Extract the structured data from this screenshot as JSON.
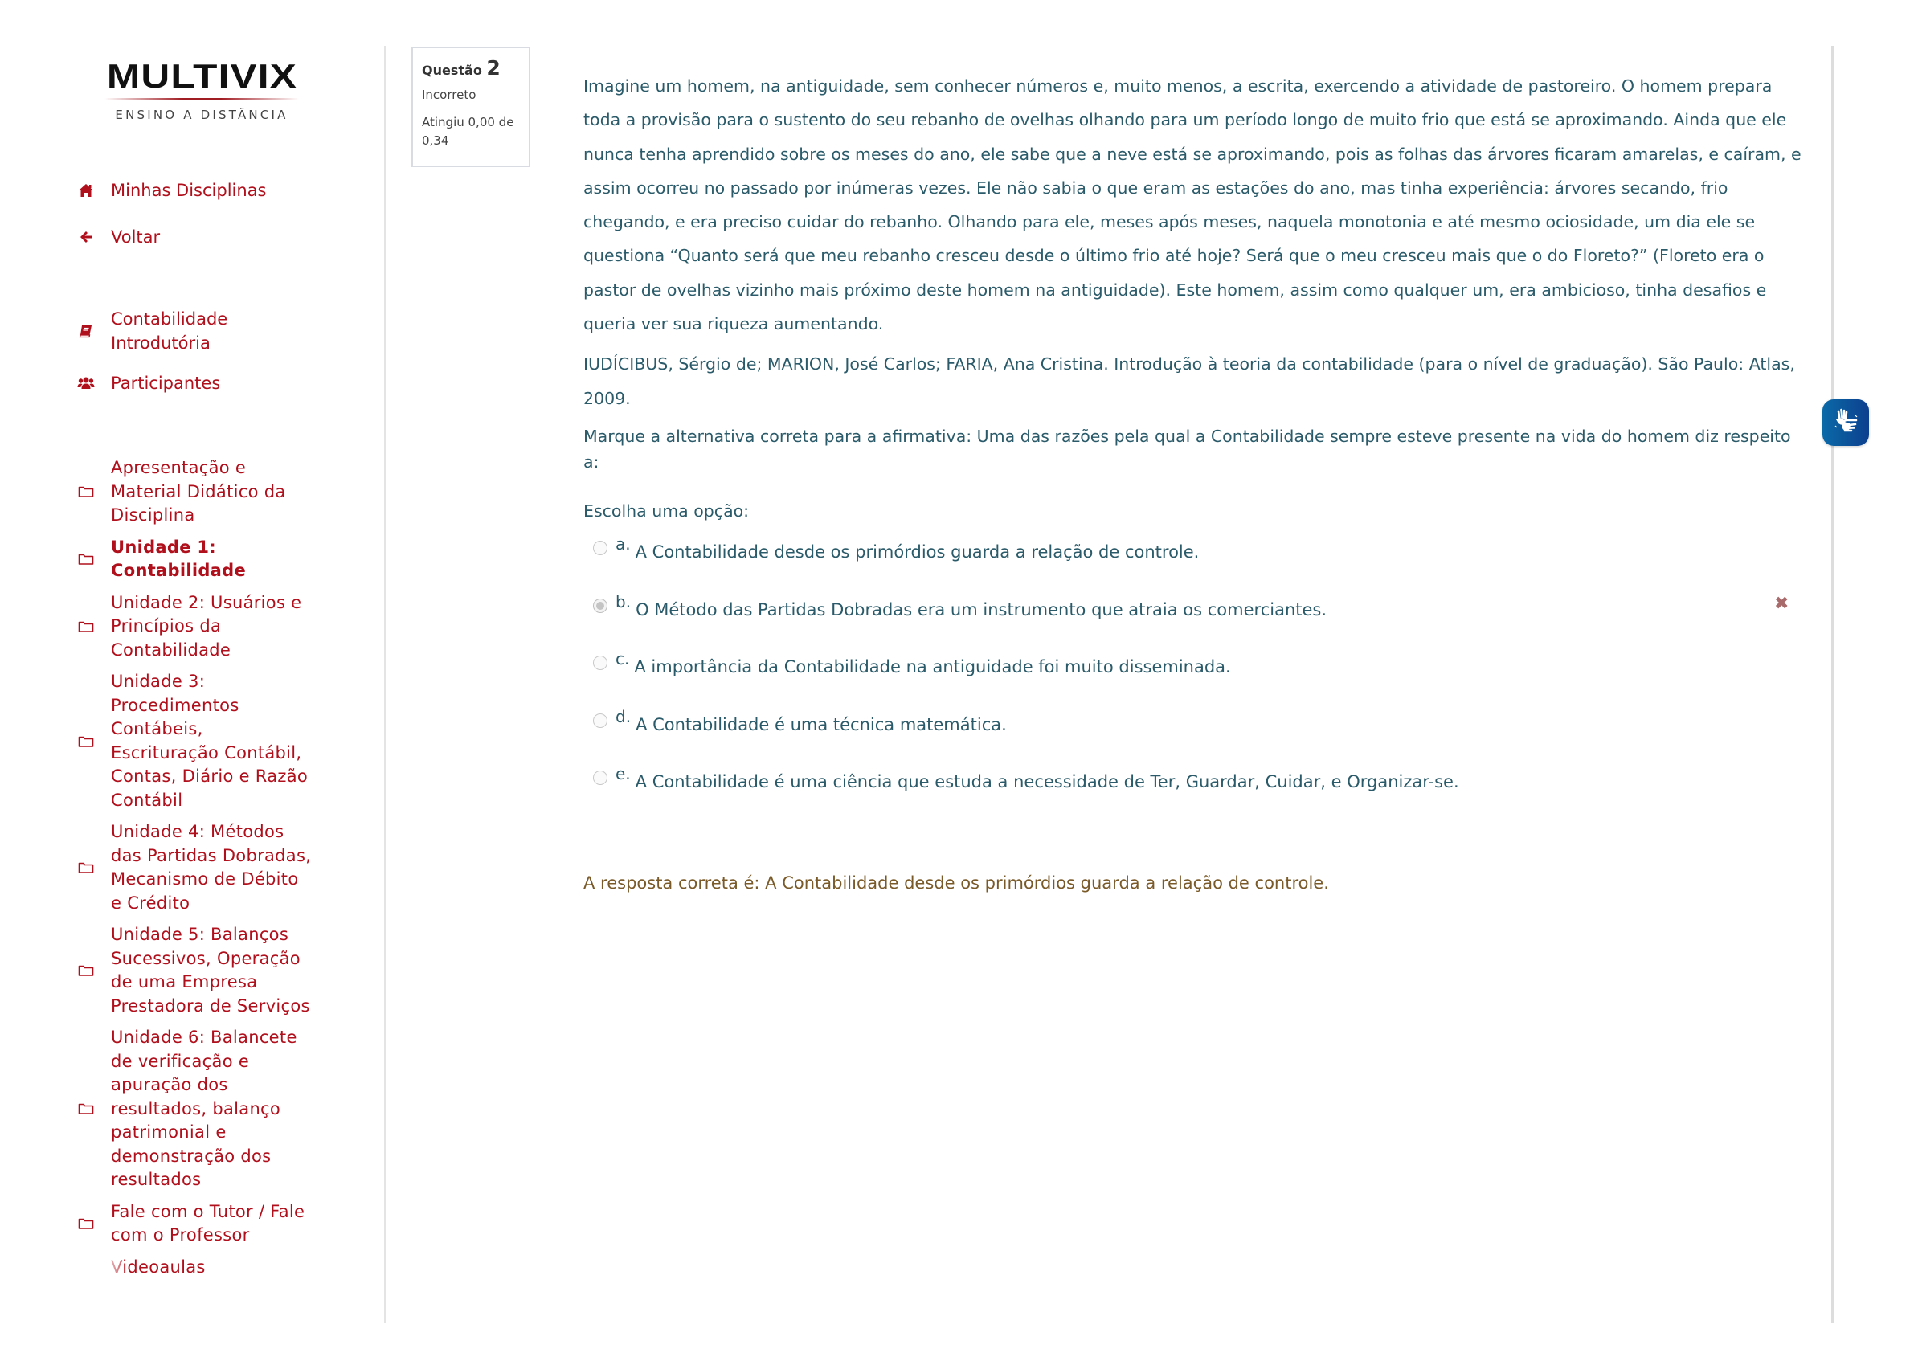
{
  "logo": {
    "main": "MULTIVIX",
    "sub": "ENSINO A DISTÂNCIA"
  },
  "nav": {
    "home": {
      "label": "Minhas Disciplinas",
      "icon": "home-icon"
    },
    "back": {
      "label": "Voltar",
      "icon": "arrow-left-icon"
    },
    "course": {
      "label": "Contabilidade Introdutória",
      "icon": "book-icon"
    },
    "participants": {
      "label": "Participantes",
      "icon": "users-icon"
    }
  },
  "sections": [
    {
      "label": "Apresentação e Material Didático da Disciplina",
      "current": false
    },
    {
      "label": "Unidade 1: Contabilidade",
      "current": true
    },
    {
      "label": "Unidade 2: Usuários e Princípios da Contabilidade",
      "current": false
    },
    {
      "label": "Unidade 3: Procedimentos Contábeis, Escrituração Contábil, Contas, Diário e Razão Contábil",
      "current": false
    },
    {
      "label": "Unidade 4: Métodos das Partidas Dobradas, Mecanismo de Débito e Crédito",
      "current": false
    },
    {
      "label": "Unidade 5: Balanços Sucessivos, Operação de uma Empresa Prestadora de Serviços",
      "current": false
    },
    {
      "label": "Unidade 6: Balancete de verificação e apuração dos resultados, balanço patrimonial e demonstração dos resultados",
      "current": false
    },
    {
      "label": "Fale com o Tutor / Fale com o Professor",
      "current": false
    },
    {
      "label": "Videoaulas",
      "current": false
    }
  ],
  "question": {
    "label": "Questão",
    "number": "2",
    "state": "Incorreto",
    "grade": "Atingiu 0,00 de 0,34",
    "text": "Imagine um homem, na antiguidade, sem conhecer números e, muito menos, a escrita, exercendo a atividade de pastoreiro. O homem prepara toda a provisão para o sustento do seu rebanho de ovelhas olhando para um período longo de muito frio que está se aproximando. Ainda que ele nunca tenha aprendido sobre os meses do ano, ele sabe que a neve está se aproximando, pois as folhas das árvores ficaram amarelas, e caíram, e assim ocorreu no passado por inúmeras vezes. Ele não sabia o que eram as estações do ano, mas tinha experiência: árvores secando, frio chegando, e era preciso cuidar do rebanho. Olhando para ele, meses após meses, naquela monotonia e até mesmo ociosidade, um dia ele se questiona “Quanto será que meu rebanho cresceu desde o último frio até hoje? Será que o meu cresceu mais que o do Floreto?” (Floreto era o pastor de ovelhas vizinho mais próximo deste homem na antiguidade). Este homem, assim como qualquer um, era ambicioso, tinha desafios e queria ver sua riqueza aumentando.",
    "reference": "IUDÍCIBUS, Sérgio de; MARION, José Carlos; FARIA, Ana Cristina. Introdução à teoria da contabilidade (para o nível de graduação). São Paulo: Atlas, 2009.",
    "prompt": "Marque a alternativa correta para a afirmativa: Uma das razões pela qual a Contabilidade sempre esteve presente na vida do homem diz respeito a:",
    "choose_label": "Escolha uma opção:",
    "answers": [
      {
        "letter": "a.",
        "text": "A Contabilidade desde os primórdios guarda a relação de controle.",
        "selected": false
      },
      {
        "letter": "b.",
        "text": "O Método das Partidas Dobradas era um instrumento que atraia os comerciantes.",
        "selected": true,
        "mark": "incorrect"
      },
      {
        "letter": "c.",
        "text": "A importância da Contabilidade na antiguidade foi muito disseminada.",
        "selected": false
      },
      {
        "letter": "d.",
        "text": "A Contabilidade é uma técnica matemática.",
        "selected": false
      },
      {
        "letter": "e.",
        "text": "A Contabilidade é uma ciência que estuda a necessidade de Ter, Guardar, Cuidar, e Organizar-se.",
        "selected": false
      }
    ],
    "feedback": "A resposta correta é: A Contabilidade desde os primórdios guarda a relação de controle."
  },
  "accessibility_widget": {
    "icon": "sign-language-hands-icon"
  },
  "colors": {
    "brand_red": "#b0101c",
    "question_text": "#2b5b6a",
    "feedback_text": "#7a5a28",
    "incorrect_mark": "#a86a6a",
    "widget_blue": "#0d4f9a"
  }
}
